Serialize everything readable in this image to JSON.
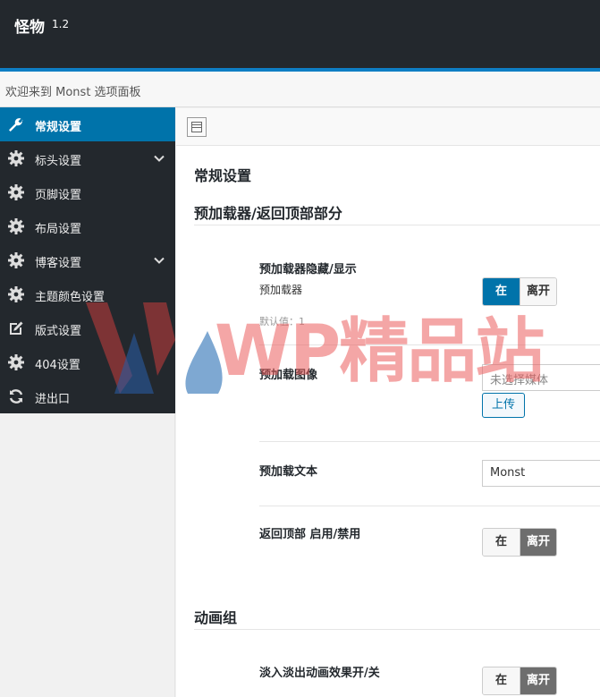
{
  "header": {
    "title": "怪物",
    "version": "1.2"
  },
  "welcome": "欢迎来到 Monst 选项面板",
  "sidebar": {
    "items": [
      {
        "label": "常规设置",
        "icon": "wrench-icon",
        "active": true,
        "has_children": false
      },
      {
        "label": "标头设置",
        "icon": "gear-icon",
        "active": false,
        "has_children": true
      },
      {
        "label": "页脚设置",
        "icon": "gear-icon",
        "active": false,
        "has_children": false
      },
      {
        "label": "布局设置",
        "icon": "gear-icon",
        "active": false,
        "has_children": false
      },
      {
        "label": "博客设置",
        "icon": "gear-icon",
        "active": false,
        "has_children": true
      },
      {
        "label": "主题颜色设置",
        "icon": "gear-icon",
        "active": false,
        "has_children": false
      },
      {
        "label": "版式设置",
        "icon": "edit-icon",
        "active": false,
        "has_children": false
      },
      {
        "label": "404设置",
        "icon": "gear-icon",
        "active": false,
        "has_children": false
      },
      {
        "label": "进出口",
        "icon": "refresh-icon",
        "active": false,
        "has_children": false
      }
    ]
  },
  "main": {
    "section_title": "常规设置",
    "preloader_section": {
      "title": "预加载器/返回顶部部分",
      "fields": {
        "preloader_toggle": {
          "label": "预加载器隐藏/显示",
          "sub": "预加载器",
          "default": "默认值：1",
          "on_label": "在",
          "off_label": "离开",
          "value": "在"
        },
        "preloader_image": {
          "label": "预加载图像",
          "placeholder": "未选择媒体",
          "upload_label": "上传"
        },
        "preloader_text": {
          "label": "预加载文本",
          "value": "Monst"
        },
        "back_to_top": {
          "label": "返回顶部 启用/禁用",
          "on_label": "在",
          "off_label": "离开",
          "value": "离开"
        }
      }
    },
    "animation_section": {
      "title": "动画组",
      "fields": {
        "fade_toggle": {
          "label": "淡入淡出动画效果开/关",
          "on_label": "在",
          "off_label": "离开",
          "value": "离开"
        }
      }
    }
  },
  "watermark": {
    "text": "WP精品站"
  },
  "colors": {
    "accent": "#0073aa",
    "topbar": "#23282d",
    "sidebar": "#23282d",
    "stripe": "#0e7ec4"
  }
}
